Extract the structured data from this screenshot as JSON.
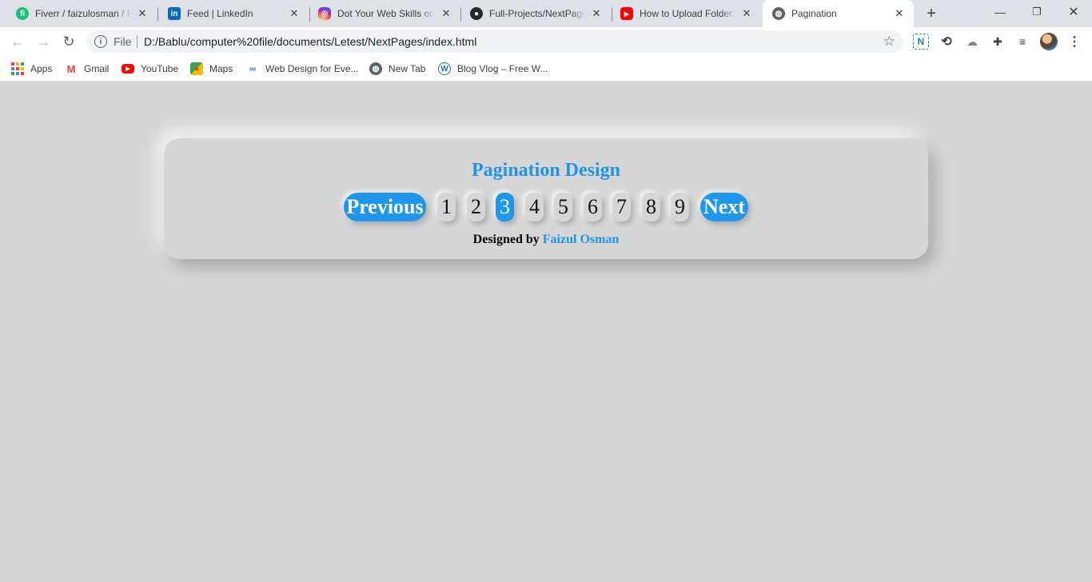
{
  "browser": {
    "tabs": [
      {
        "title": "Fiverr / faizulosman / Bu",
        "icon": "fiverr-icon",
        "color": "#1dbf73"
      },
      {
        "title": "Feed | LinkedIn",
        "icon": "linkedin-icon",
        "color": "#0a66c2"
      },
      {
        "title": "Dot Your Web Skills on",
        "icon": "instagram-icon",
        "color": "#e1306c"
      },
      {
        "title": "Full-Projects/NextPages",
        "icon": "github-icon",
        "color": "#24292e"
      },
      {
        "title": "How to Upload Folder a",
        "icon": "youtube-icon",
        "color": "#ff0000"
      },
      {
        "title": "Pagination",
        "icon": "globe-icon",
        "color": "#5f6368"
      }
    ],
    "active_tab": 5,
    "address": {
      "scheme_label": "File",
      "url": "D:/Bablu/computer%20file/documents/Letest/NextPages/index.html"
    },
    "bookmarks": [
      {
        "label": "Apps",
        "icon": "apps-grid-icon"
      },
      {
        "label": "Gmail",
        "icon": "gmail-icon"
      },
      {
        "label": "YouTube",
        "icon": "youtube-icon"
      },
      {
        "label": "Maps",
        "icon": "maps-icon"
      },
      {
        "label": "Web Design for Eve...",
        "icon": "link-icon"
      },
      {
        "label": "New Tab",
        "icon": "globe-icon"
      },
      {
        "label": "Blog Vlog – Free W...",
        "icon": "wordpress-icon"
      }
    ]
  },
  "page": {
    "title": "Pagination Design",
    "pagination": {
      "previous_label": "Previous",
      "next_label": "Next",
      "pages": [
        "1",
        "2",
        "3",
        "4",
        "5",
        "6",
        "7",
        "8",
        "9"
      ],
      "active_page": "3"
    },
    "credit": {
      "prefix": "Designed by",
      "author": "Faizul Osman"
    }
  },
  "colors": {
    "accent": "#1d96ec",
    "background": "#d6d6d6"
  }
}
